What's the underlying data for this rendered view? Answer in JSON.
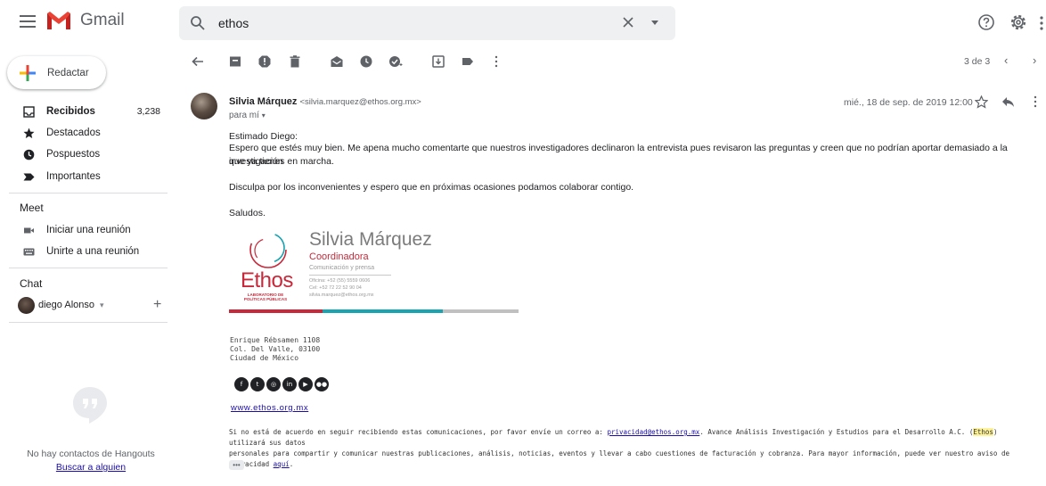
{
  "header": {
    "app_name": "Gmail",
    "search_value": "ethos"
  },
  "sidebar": {
    "compose_label": "Redactar",
    "items": [
      {
        "label": "Recibidos",
        "count": "3,238"
      },
      {
        "label": "Destacados"
      },
      {
        "label": "Pospuestos"
      },
      {
        "label": "Importantes"
      }
    ],
    "meet": {
      "title": "Meet",
      "items": [
        {
          "label": "Iniciar una reunión"
        },
        {
          "label": "Unirte a una reunión"
        }
      ]
    },
    "chat": {
      "title": "Chat",
      "user": "diego Alonso",
      "caret": "▾",
      "add": "+"
    },
    "hangouts": {
      "empty_text": "No hay contactos de Hangouts",
      "search_link": "Buscar a alguien"
    }
  },
  "toolbar": {
    "pager": "3 de 3"
  },
  "message": {
    "sender_name": "Silvia Márquez",
    "sender_email": "<silvia.marquez@ethos.org.mx>",
    "recipient": "para mí",
    "date": "mié., 18 de sep. de 2019 12:00",
    "greeting": "Estimado Diego:",
    "paragraph1_line1": "Espero que estés muy bien. Me apena mucho comentarte que nuestros investigadores declinaron la entrevista pues revisaron las preguntas y creen que no podrían aportar demasiado a la investigación",
    "paragraph1_line2": "que ya tienes en marcha.",
    "paragraph2": "Disculpa por los inconvenientes y espero que en próximas ocasiones podamos colaborar contigo.",
    "closing": "Saludos.",
    "signature": {
      "name": "Silvia Márquez",
      "role": "Coordinadora",
      "department": "Comunicación y prensa",
      "contact_1": "Oficina: +52 (55) 5559 0606",
      "contact_2": "Cel: +52 72 22 52 90 04",
      "contact_3": "silvia.marquez@ethos.org.mx",
      "org_word": "Ethos",
      "org_sub": "LABORATORIO DE POLÍTICAS PÚBLICAS",
      "bar_colors": [
        "#c8283a",
        "#1aa3b0",
        "#c0c0c0"
      ]
    },
    "address": {
      "line1": "Enrique Rébsamen 1108",
      "line2": "Col. Del Valle, 03100",
      "line3": "Ciudad de México"
    },
    "website": "www.ethos.org.mx",
    "disclaimer": {
      "part1": "Si no está de acuerdo en seguir recibiendo estas comunicaciones, por favor envíe un correo a: ",
      "email_link": "privacidad@ethos.org.mx",
      "part2": ". Avance Análisis Investigación y Estudios para el Desarrollo A.C. (",
      "highlight": "Ethos",
      "part3": ") utilizará sus datos",
      "part4": "personales para compartir y comunicar nuestras publicaciones, análisis, noticias, eventos y llevar a cabo cuestiones de facturación y cobranza. Para mayor información, puede ver nuestro aviso de privacidad ",
      "aqui_link": "aquí",
      "part5": "."
    },
    "trimmed": "•••"
  },
  "colors": {
    "gmail_red": "#ea4335",
    "link": "#1a0dab",
    "ethos_red": "#c8283a",
    "ethos_teal": "#1aa3b0"
  }
}
